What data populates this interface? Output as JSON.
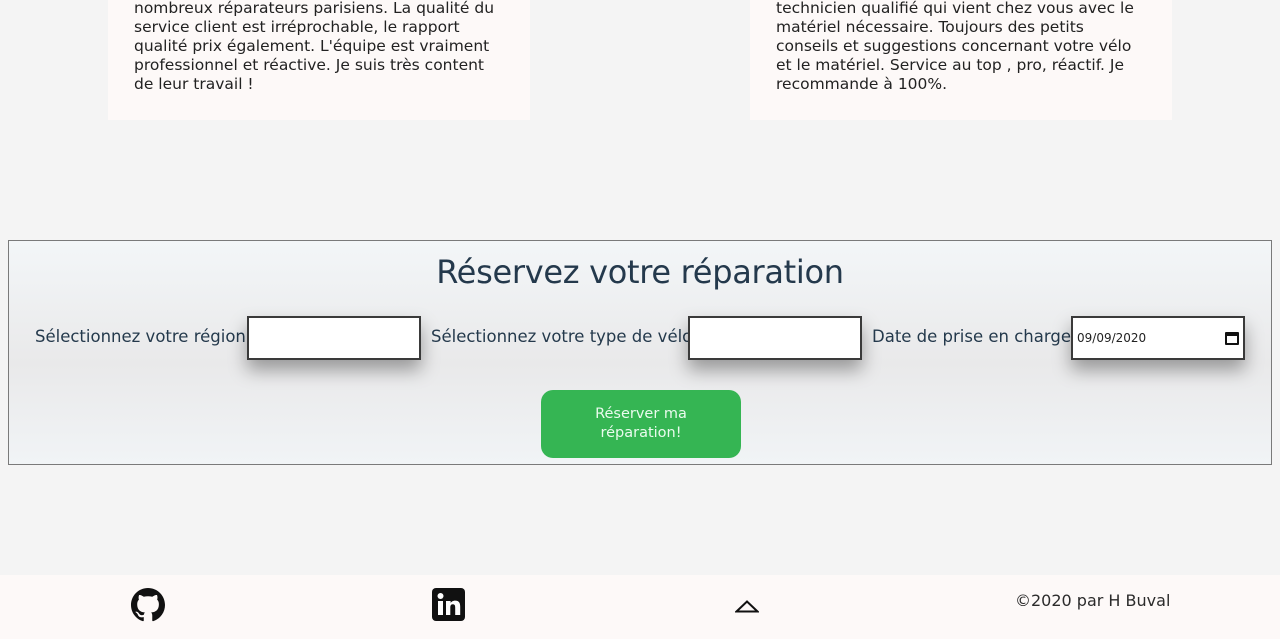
{
  "testimonials": [
    {
      "text": "nombreux réparateurs parisiens. La qualité du service client est irréprochable, le rapport qualité prix également. L'équipe est vraiment professionnel et réactive. Je suis très content de leur travail !"
    },
    {
      "text": "technicien qualifié qui vient chez vous avec le matériel nécessaire. Toujours des petits conseils et suggestions concernant votre vélo et le matériel. Service au top , pro, réactif. Je recommande à 100%."
    }
  ],
  "booking": {
    "title": "Réservez votre réparation",
    "region_label": "Sélectionnez votre région:",
    "region_value": "",
    "bike_label": "Sélectionnez votre type de vélo:",
    "bike_value": "",
    "date_label": "Date de prise en charge:",
    "date_value": "09/09/2020",
    "submit_label": "Réserver ma réparation!"
  },
  "footer": {
    "icons": [
      "github-icon",
      "linkedin-icon",
      "chevron-up-icon"
    ],
    "copyright": "©2020 par H Buval"
  },
  "colors": {
    "accent_green": "#35b553",
    "title_navy": "#24394c",
    "card_bg": "#fdf9f8"
  }
}
